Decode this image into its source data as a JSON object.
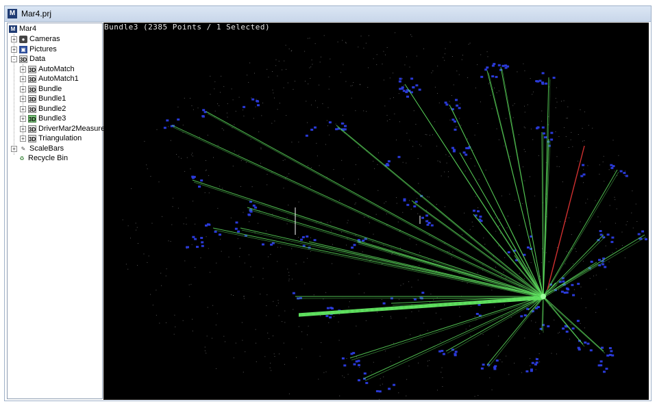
{
  "window": {
    "title": "Mar4.prj"
  },
  "tree": {
    "root": "Mar4",
    "items": [
      {
        "label": "Cameras",
        "icon": "camera-icon",
        "expander": "+"
      },
      {
        "label": "Pictures",
        "icon": "picture-icon",
        "expander": "+"
      },
      {
        "label": "Data",
        "icon": "data-3d-icon",
        "expander": "-"
      }
    ],
    "data_children": [
      {
        "label": "AutoMatch",
        "icon": "3d"
      },
      {
        "label": "AutoMatch1",
        "icon": "3d"
      },
      {
        "label": "Bundle",
        "icon": "3d"
      },
      {
        "label": "Bundle1",
        "icon": "3d"
      },
      {
        "label": "Bundle2",
        "icon": "3d"
      },
      {
        "label": "Bundle3",
        "icon": "3d",
        "active": true
      },
      {
        "label": "DriverMar2Measure",
        "icon": "3d"
      },
      {
        "label": "Triangulation",
        "icon": "3d"
      }
    ],
    "after": [
      {
        "label": "ScaleBars",
        "icon": "scalebar-icon",
        "expander": "+"
      },
      {
        "label": "Recycle Bin",
        "icon": "recycle-bin-icon"
      }
    ],
    "icon_text": "3D"
  },
  "viewport": {
    "label": "Bundle3 (2385 Points / 1 Selected)",
    "colors": {
      "background": "#000000",
      "rays": "#5fe05f",
      "selected_ray": "#d03030",
      "targets": "#2a3ad8",
      "points": "#a0a0a0"
    }
  }
}
